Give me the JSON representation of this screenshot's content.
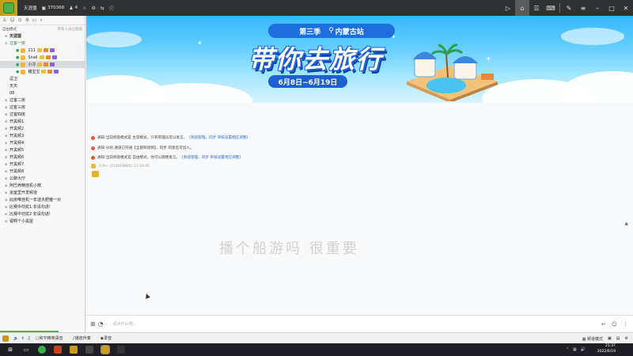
{
  "titlebar": {
    "channel_name": "天涯盟",
    "channel_id": "370368",
    "online_count": "4"
  },
  "sidebar": {
    "mode_label": "自由模式",
    "mode_hint": "带有人员让频道",
    "tree": [
      {
        "label": "天涯盟",
        "level": 0,
        "bold": true
      },
      {
        "label": "过客一房",
        "level": 0,
        "green": true
      },
      {
        "label": "111",
        "level": 2
      },
      {
        "label": "Snail",
        "level": 2
      },
      {
        "label": "小冷",
        "level": 2,
        "selected": true
      },
      {
        "label": "猪宝宝",
        "level": 2
      },
      {
        "label": "逗卫",
        "level": 1
      },
      {
        "label": "天天",
        "level": 1
      },
      {
        "label": "08",
        "level": 1
      },
      {
        "label": "过客二房",
        "level": 0
      },
      {
        "label": "过客三房",
        "level": 0
      },
      {
        "label": "过客四房",
        "level": 0
      },
      {
        "label": "开黑频1",
        "level": 0
      },
      {
        "label": "开黑频2",
        "level": 0
      },
      {
        "label": "开黑频3",
        "level": 0
      },
      {
        "label": "开黑频4",
        "level": 0
      },
      {
        "label": "开黑频5",
        "level": 0
      },
      {
        "label": "开黑频6",
        "level": 0
      },
      {
        "label": "开黑频7",
        "level": 0
      },
      {
        "label": "开黑频8",
        "level": 0
      },
      {
        "label": "公聊大厅",
        "level": 0
      },
      {
        "label": "阿巴养精挂机小窝",
        "level": 0
      },
      {
        "label": "追室里开发频道",
        "level": 0
      },
      {
        "label": "此房唯挂机一年送大肥猪一对",
        "level": 0
      },
      {
        "label": "比赛中勿扰1 非请勿进!",
        "level": 0
      },
      {
        "label": "比赛中勿扰2 非请勿进!",
        "level": 0
      },
      {
        "label": "寝啊个小黑屋",
        "level": 0
      }
    ]
  },
  "banner": {
    "season": "第三季",
    "station": "内蒙古站",
    "title": "带你去旅行",
    "dates": "6月8日~6月19日"
  },
  "chat": {
    "messages": [
      {
        "prefix": "通知:",
        "text": "当前频道模式是 主席模式，只有管理员可以发言。",
        "link": "[频道管理，同步 审核设置相应调整]"
      },
      {
        "prefix": "通知:",
        "text": "分组 通道已开通【全部频道频】，同步 同意后可加入。",
        "link": ""
      },
      {
        "prefix": "通知:",
        "text": "当前频道模式是 自由模式，你可以随便发言。",
        "link": "[频道管理，同步 审核设置相应调整]"
      }
    ],
    "sender": "小冷+ (251019865) 21:10:45",
    "overlay": "播个船游吗 很重要",
    "input_placeholder": "说点什么吧..."
  },
  "statusbar": {
    "item1": "和平精英语音",
    "item2": "播放伴奏",
    "item3": "录音",
    "right_mode": "频道模式"
  },
  "taskbar": {
    "time": "21:37",
    "date": "2022/6/19"
  }
}
